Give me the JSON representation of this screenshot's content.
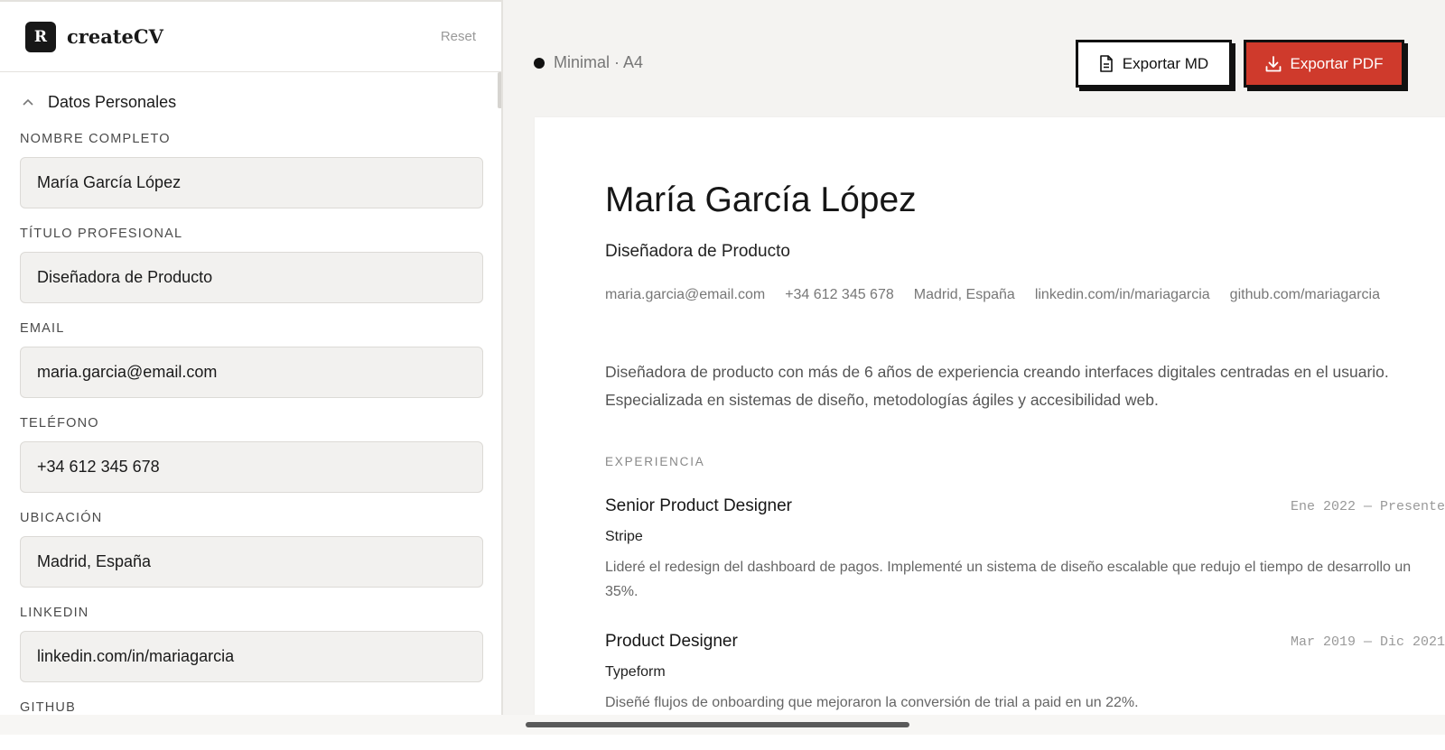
{
  "brand": {
    "logo_letter": "R",
    "name": "createCV",
    "reset_label": "Reset"
  },
  "section": {
    "title": "Datos Personales"
  },
  "fields": [
    {
      "label": "NOMBRE COMPLETO",
      "value": "María García López"
    },
    {
      "label": "TÍTULO PROFESIONAL",
      "value": "Diseñadora de Producto"
    },
    {
      "label": "EMAIL",
      "value": "maria.garcia@email.com"
    },
    {
      "label": "TELÉFONO",
      "value": "+34 612 345 678"
    },
    {
      "label": "UBICACIÓN",
      "value": "Madrid, España"
    },
    {
      "label": "LINKEDIN",
      "value": "linkedin.com/in/mariagarcia"
    },
    {
      "label": "GITHUB",
      "value": ""
    }
  ],
  "toolbar": {
    "template_label": "Minimal · A4",
    "export_md_label": "Exportar MD",
    "export_pdf_label": "Exportar PDF",
    "accent_color": "#cf3a2c"
  },
  "cv": {
    "name": "María García López",
    "title": "Diseñadora de Producto",
    "contacts": [
      "maria.garcia@email.com",
      "+34 612 345 678",
      "Madrid, España",
      "linkedin.com/in/mariagarcia",
      "github.com/mariagarcia"
    ],
    "summary": "Diseñadora de producto con más de 6 años de experiencia creando interfaces digitales centradas en el usuario. Especializada en sistemas de diseño, metodologías ágiles y accesibilidad web.",
    "experience_label": "EXPERIENCIA",
    "experience": [
      {
        "role": "Senior Product Designer",
        "date": "Ene 2022 — Presente",
        "company": "Stripe",
        "description": "Lideré el redesign del dashboard de pagos. Implementé un sistema de diseño escalable que redujo el tiempo de desarrollo un 35%."
      },
      {
        "role": "Product Designer",
        "date": "Mar 2019 — Dic 2021",
        "company": "Typeform",
        "description": "Diseñé flujos de onboarding que mejoraron la conversión de trial a paid en un 22%."
      }
    ]
  }
}
